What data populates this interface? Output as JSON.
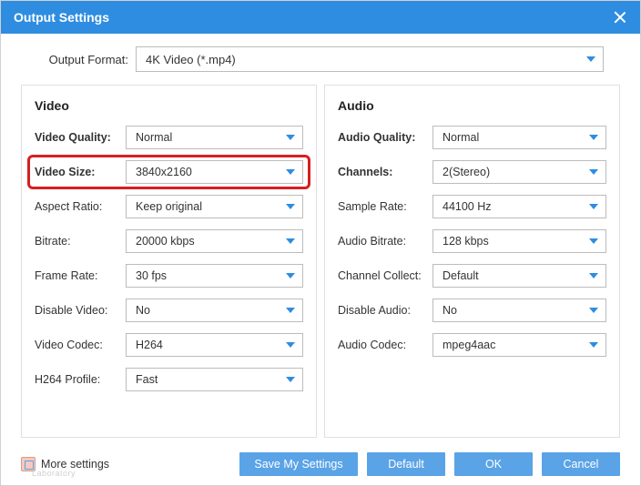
{
  "title": "Output Settings",
  "output_format": {
    "label": "Output Format:",
    "value": "4K Video (*.mp4)"
  },
  "video": {
    "heading": "Video",
    "quality": {
      "label": "Video Quality:",
      "value": "Normal"
    },
    "size": {
      "label": "Video Size:",
      "value": "3840x2160"
    },
    "aspect": {
      "label": "Aspect Ratio:",
      "value": "Keep original"
    },
    "bitrate": {
      "label": "Bitrate:",
      "value": "20000 kbps"
    },
    "framerate": {
      "label": "Frame Rate:",
      "value": "30 fps"
    },
    "disable": {
      "label": "Disable Video:",
      "value": "No"
    },
    "codec": {
      "label": "Video Codec:",
      "value": "H264"
    },
    "profile": {
      "label": "H264 Profile:",
      "value": "Fast"
    }
  },
  "audio": {
    "heading": "Audio",
    "quality": {
      "label": "Audio Quality:",
      "value": "Normal"
    },
    "channels": {
      "label": "Channels:",
      "value": "2(Stereo)"
    },
    "samplerate": {
      "label": "Sample Rate:",
      "value": "44100 Hz"
    },
    "bitrate": {
      "label": "Audio Bitrate:",
      "value": "128 kbps"
    },
    "collect": {
      "label": "Channel Collect:",
      "value": "Default"
    },
    "disable": {
      "label": "Disable Audio:",
      "value": "No"
    },
    "codec": {
      "label": "Audio Codec:",
      "value": "mpeg4aac"
    }
  },
  "buttons": {
    "more": "More settings",
    "save": "Save My Settings",
    "default": "Default",
    "ok": "OK",
    "cancel": "Cancel"
  },
  "watermark": "Laboratory"
}
